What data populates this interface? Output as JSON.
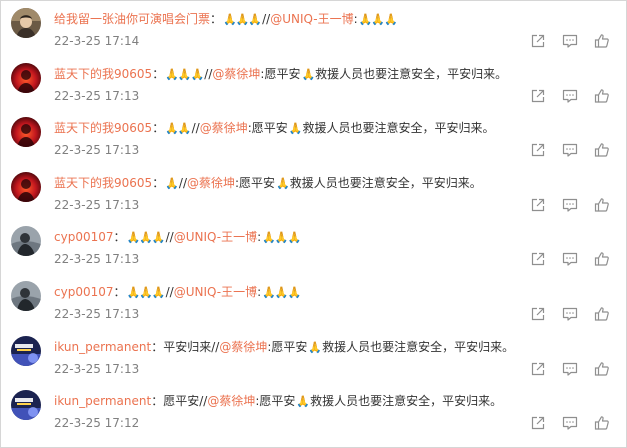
{
  "colors": {
    "accent": "#eb7350",
    "text": "#333333",
    "muted": "#808080",
    "icon": "#8f8f8f"
  },
  "icons": {
    "prayer": "🙏",
    "forward": "share-icon",
    "reply": "comment-icon",
    "like": "like-icon"
  },
  "comments": [
    {
      "avatar": "avatar-concert-portrait",
      "user": "给我留一张油你可演唱会门票",
      "sep": "：",
      "segments": [
        {
          "t": "emoji",
          "v": "🙏🙏🙏"
        },
        {
          "t": "text",
          "v": "//"
        },
        {
          "t": "mention",
          "v": "@UNIQ-王一博"
        },
        {
          "t": "text",
          "v": ":"
        },
        {
          "t": "emoji",
          "v": "🙏🙏🙏"
        }
      ],
      "time": "22-3-25 17:14"
    },
    {
      "avatar": "avatar-red-glow",
      "user": "蓝天下的我90605",
      "sep": "：",
      "segments": [
        {
          "t": "emoji",
          "v": "🙏🙏🙏"
        },
        {
          "t": "text",
          "v": "//"
        },
        {
          "t": "mention",
          "v": "@蔡徐坤"
        },
        {
          "t": "text",
          "v": ":愿平安"
        },
        {
          "t": "emoji",
          "v": "🙏"
        },
        {
          "t": "text",
          "v": "救援人员也要注意安全，平安归来。"
        }
      ],
      "time": "22-3-25 17:13"
    },
    {
      "avatar": "avatar-red-glow",
      "user": "蓝天下的我90605",
      "sep": "：",
      "segments": [
        {
          "t": "emoji",
          "v": "🙏🙏"
        },
        {
          "t": "text",
          "v": "//"
        },
        {
          "t": "mention",
          "v": "@蔡徐坤"
        },
        {
          "t": "text",
          "v": ":愿平安"
        },
        {
          "t": "emoji",
          "v": "🙏"
        },
        {
          "t": "text",
          "v": "救援人员也要注意安全，平安归来。"
        }
      ],
      "time": "22-3-25 17:13"
    },
    {
      "avatar": "avatar-red-glow",
      "user": "蓝天下的我90605",
      "sep": "：",
      "segments": [
        {
          "t": "emoji",
          "v": "🙏"
        },
        {
          "t": "text",
          "v": "//"
        },
        {
          "t": "mention",
          "v": "@蔡徐坤"
        },
        {
          "t": "text",
          "v": ":愿平安"
        },
        {
          "t": "emoji",
          "v": "🙏"
        },
        {
          "t": "text",
          "v": "救援人员也要注意安全，平安归来。"
        }
      ],
      "time": "22-3-25 17:13"
    },
    {
      "avatar": "avatar-dark-figure",
      "user": "cyp00107",
      "sep": "：",
      "segments": [
        {
          "t": "emoji",
          "v": "🙏🙏🙏"
        },
        {
          "t": "text",
          "v": "//"
        },
        {
          "t": "mention",
          "v": "@UNIQ-王一博"
        },
        {
          "t": "text",
          "v": ":"
        },
        {
          "t": "emoji",
          "v": "🙏🙏🙏"
        }
      ],
      "time": "22-3-25 17:13"
    },
    {
      "avatar": "avatar-dark-figure",
      "user": "cyp00107",
      "sep": "：",
      "segments": [
        {
          "t": "emoji",
          "v": "🙏🙏🙏"
        },
        {
          "t": "text",
          "v": "//"
        },
        {
          "t": "mention",
          "v": "@UNIQ-王一博"
        },
        {
          "t": "text",
          "v": ":"
        },
        {
          "t": "emoji",
          "v": "🙏🙏🙏"
        }
      ],
      "time": "22-3-25 17:13"
    },
    {
      "avatar": "avatar-blue-poster",
      "user": "ikun_permanent",
      "sep": "：",
      "segments": [
        {
          "t": "text",
          "v": "平安归来//"
        },
        {
          "t": "mention",
          "v": "@蔡徐坤"
        },
        {
          "t": "text",
          "v": ":愿平安"
        },
        {
          "t": "emoji",
          "v": "🙏"
        },
        {
          "t": "text",
          "v": "救援人员也要注意安全，平安归来。"
        }
      ],
      "time": "22-3-25 17:13"
    },
    {
      "avatar": "avatar-blue-poster",
      "user": "ikun_permanent",
      "sep": "：",
      "segments": [
        {
          "t": "text",
          "v": "愿平安//"
        },
        {
          "t": "mention",
          "v": "@蔡徐坤"
        },
        {
          "t": "text",
          "v": ":愿平安"
        },
        {
          "t": "emoji",
          "v": "🙏"
        },
        {
          "t": "text",
          "v": "救援人员也要注意安全，平安归来。"
        }
      ],
      "time": "22-3-25 17:12"
    }
  ]
}
